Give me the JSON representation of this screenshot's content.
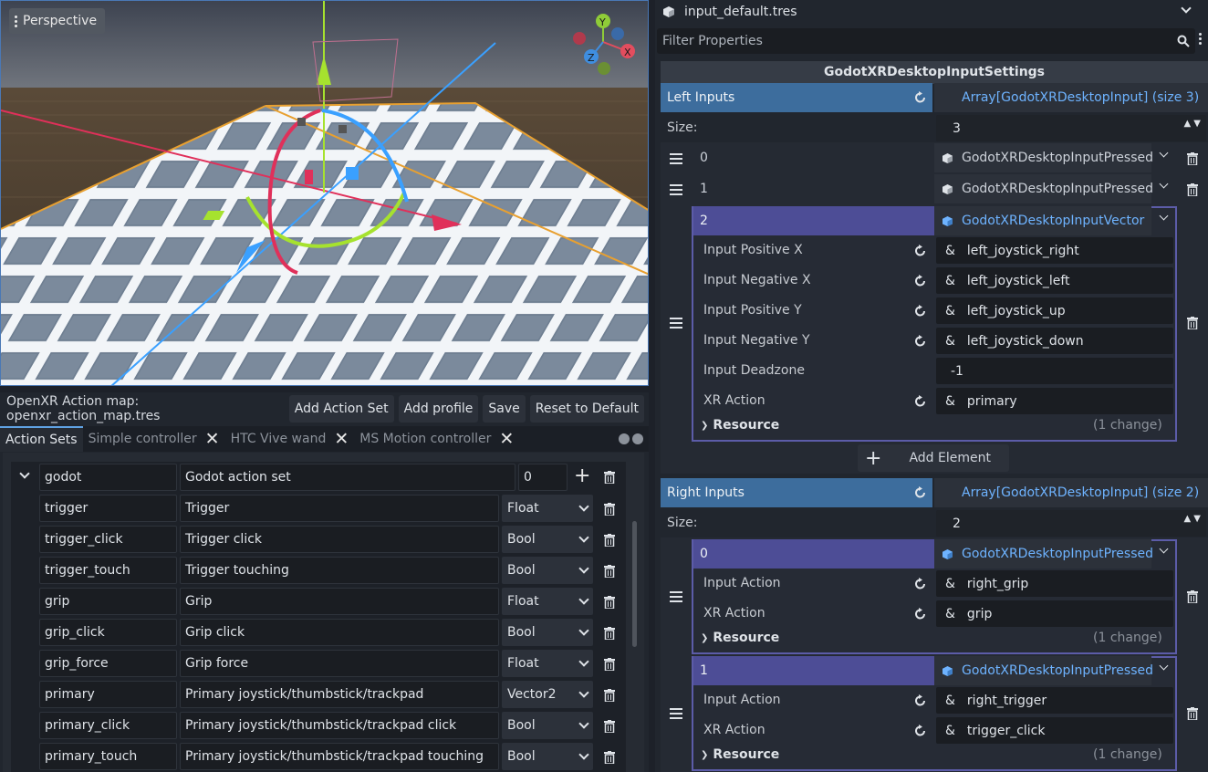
{
  "viewport": {
    "mode_label": "Perspective",
    "gizmo_axes": [
      "Y",
      "X",
      "Z"
    ]
  },
  "action_map": {
    "title": "OpenXR Action map: openxr_action_map.tres",
    "buttons": [
      "Add Action Set",
      "Add profile",
      "Save",
      "Reset to Default"
    ],
    "tabs": [
      {
        "label": "Action Sets",
        "closable": false
      },
      {
        "label": "Simple controller",
        "closable": true
      },
      {
        "label": "HTC Vive wand",
        "closable": true
      },
      {
        "label": "MS Motion controller",
        "closable": true
      }
    ],
    "action_set": {
      "name": "godot",
      "label": "Godot action set",
      "priority": "0"
    },
    "actions": [
      {
        "name": "trigger",
        "label": "Trigger",
        "type": "Float"
      },
      {
        "name": "trigger_click",
        "label": "Trigger click",
        "type": "Bool"
      },
      {
        "name": "trigger_touch",
        "label": "Trigger touching",
        "type": "Bool"
      },
      {
        "name": "grip",
        "label": "Grip",
        "type": "Float"
      },
      {
        "name": "grip_click",
        "label": "Grip click",
        "type": "Bool"
      },
      {
        "name": "grip_force",
        "label": "Grip force",
        "type": "Float"
      },
      {
        "name": "primary",
        "label": "Primary joystick/thumbstick/trackpad",
        "type": "Vector2"
      },
      {
        "name": "primary_click",
        "label": "Primary joystick/thumbstick/trackpad click",
        "type": "Bool"
      },
      {
        "name": "primary_touch",
        "label": "Primary joystick/thumbstick/trackpad touching",
        "type": "Bool"
      }
    ]
  },
  "inspector": {
    "resource": "input_default.tres",
    "filter_placeholder": "Filter Properties",
    "class_name": "GodotXRDesktopInputSettings",
    "left": {
      "label": "Left Inputs",
      "array": "Array[GodotXRDesktopInput] (size 3)",
      "size_label": "Size:",
      "size": "3",
      "items": [
        {
          "index": "0",
          "type": "GodotXRDesktopInputPressed"
        },
        {
          "index": "1",
          "type": "GodotXRDesktopInputPressed"
        },
        {
          "index": "2",
          "type": "GodotXRDesktopInputVector"
        }
      ],
      "vector_props": [
        {
          "label": "Input Positive X",
          "value": "left_joystick_right"
        },
        {
          "label": "Input Negative X",
          "value": "left_joystick_left"
        },
        {
          "label": "Input Positive Y",
          "value": "left_joystick_up"
        },
        {
          "label": "Input Negative Y",
          "value": "left_joystick_down"
        },
        {
          "label": "Input Deadzone",
          "value": "-1"
        },
        {
          "label": "XR Action",
          "value": "primary"
        }
      ],
      "resource_label": "Resource",
      "change": "(1 change)",
      "add_element": "Add Element"
    },
    "right": {
      "label": "Right Inputs",
      "array": "Array[GodotXRDesktopInput] (size 2)",
      "size_label": "Size:",
      "size": "2",
      "items": [
        {
          "index": "0",
          "type": "GodotXRDesktopInputPressed",
          "props": [
            {
              "label": "Input Action",
              "value": "right_grip"
            },
            {
              "label": "XR Action",
              "value": "grip"
            }
          ]
        },
        {
          "index": "1",
          "type": "GodotXRDesktopInputPressed",
          "props": [
            {
              "label": "Input Action",
              "value": "right_trigger"
            },
            {
              "label": "XR Action",
              "value": "trigger_click"
            }
          ]
        }
      ],
      "resource_label": "Resource",
      "change": "(1 change)"
    },
    "amp": "&"
  }
}
